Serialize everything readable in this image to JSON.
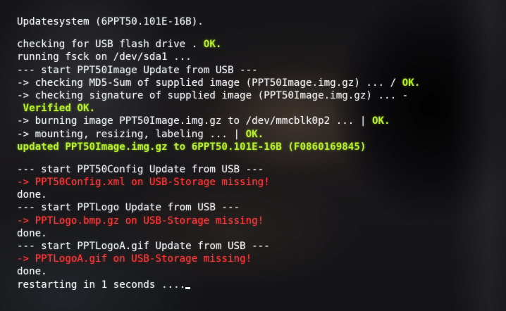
{
  "terminal": {
    "lines": [
      {
        "parts": [
          {
            "text": "Updatesystem (6PPT50.101E-16B).",
            "color": "white"
          }
        ]
      },
      {
        "blank": true
      },
      {
        "parts": [
          {
            "text": "checking for USB flash drive . ",
            "color": "white"
          },
          {
            "text": "OK.",
            "color": "green"
          }
        ]
      },
      {
        "parts": [
          {
            "text": "running fsck on /dev/sda1 ...",
            "color": "white"
          }
        ]
      },
      {
        "parts": [
          {
            "text": "--- start PPT50Image Update from USB ---",
            "color": "white"
          }
        ]
      },
      {
        "parts": [
          {
            "text": "-> checking MD5-Sum of supplied image (PPT50Image.img.gz) ... / ",
            "color": "white"
          },
          {
            "text": "OK.",
            "color": "green"
          }
        ]
      },
      {
        "parts": [
          {
            "text": "-> checking signature of supplied image (PPT50Image.img.gz) ... -",
            "color": "white"
          }
        ]
      },
      {
        "parts": [
          {
            "text": " Verified OK.",
            "color": "green"
          }
        ]
      },
      {
        "parts": [
          {
            "text": "-> burning image PPT50Image.img.gz to /dev/mmcblk0p2 ... | ",
            "color": "white"
          },
          {
            "text": "OK.",
            "color": "green"
          }
        ]
      },
      {
        "parts": [
          {
            "text": "-> mounting, resizing, labeling ... | ",
            "color": "white"
          },
          {
            "text": "OK.",
            "color": "green"
          }
        ]
      },
      {
        "parts": [
          {
            "text": "updated PPT50Image.img.gz to 6PPT50.101E-16B (F0860169845)",
            "color": "green"
          }
        ]
      },
      {
        "blank": true
      },
      {
        "parts": [
          {
            "text": "--- start PPT50Config Update from USB ---",
            "color": "white"
          }
        ]
      },
      {
        "parts": [
          {
            "text": "-> PPT50Config.xml on USB-Storage missing!",
            "color": "red"
          }
        ]
      },
      {
        "parts": [
          {
            "text": "done.",
            "color": "white"
          }
        ]
      },
      {
        "parts": [
          {
            "text": "--- start PPTLogo Update from USB ---",
            "color": "white"
          }
        ]
      },
      {
        "parts": [
          {
            "text": "-> PPTLogo.bmp.gz on USB-Storage missing!",
            "color": "red"
          }
        ]
      },
      {
        "parts": [
          {
            "text": "done.",
            "color": "white"
          }
        ]
      },
      {
        "parts": [
          {
            "text": "--- start PPTLogoA.gif Update from USB ---",
            "color": "white"
          }
        ]
      },
      {
        "parts": [
          {
            "text": "-> PPTLogoA.gif on USB-Storage missing!",
            "color": "red"
          }
        ]
      },
      {
        "parts": [
          {
            "text": "done.",
            "color": "white"
          }
        ]
      },
      {
        "parts": [
          {
            "text": "restarting in 1 seconds ....",
            "color": "white"
          }
        ],
        "cursor": true
      }
    ]
  },
  "colors": {
    "text": "#e9ecef",
    "ok_green": "#b6f02c",
    "error_red": "#ff3b3b",
    "background": "#151517"
  }
}
